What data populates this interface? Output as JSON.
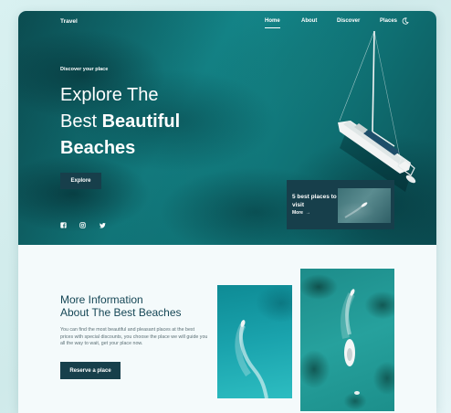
{
  "nav": {
    "logo": "Travel",
    "links": [
      {
        "label": "Home",
        "active": true
      },
      {
        "label": "About",
        "active": false
      },
      {
        "label": "Discover",
        "active": false
      },
      {
        "label": "Places",
        "active": false
      }
    ],
    "theme_icon": "moon-icon"
  },
  "hero": {
    "eyebrow": "Discover your place",
    "title_line1": "Explore The",
    "title_line2_plain": "Best ",
    "title_line2_bold": "Beautiful",
    "title_line3": "Beaches",
    "button_label": "Explore",
    "social_icons": [
      "facebook-icon",
      "instagram-icon",
      "twitter-icon"
    ],
    "card": {
      "text": "5 best places to visit",
      "more_label": "More",
      "more_icon": "arrow-right-icon"
    }
  },
  "info": {
    "title_line1": "More Information",
    "title_line2": "About The Best Beaches",
    "description": "You can find the most beautiful and pleasant places at the best prices with special discounts, you choose the place we will guide you all the way to wait, get your place now.",
    "button_label": "Reserve a place"
  },
  "colors": {
    "primary_dark": "#173f4b",
    "heading": "#164756",
    "body_text": "#5c7076",
    "sea": "#14878a"
  }
}
